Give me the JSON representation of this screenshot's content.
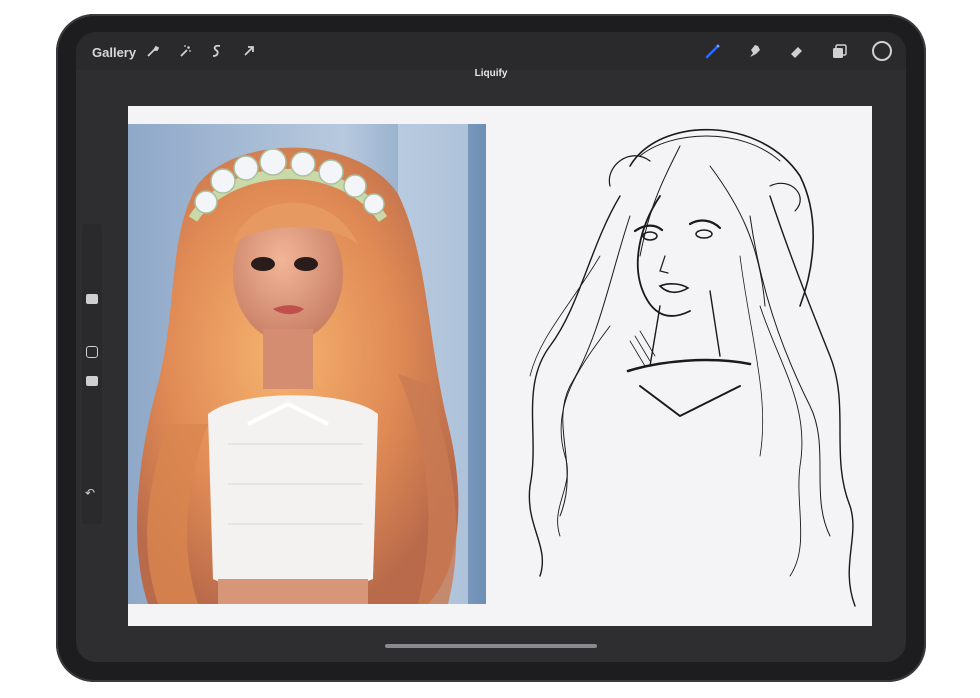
{
  "toolbar": {
    "gallery_label": "Gallery",
    "left_tools": [
      "wrench-icon",
      "magic-wand-icon",
      "selection-icon",
      "move-arrow-icon"
    ],
    "right_tools": [
      "brush-icon",
      "smudge-icon",
      "eraser-icon",
      "layers-icon",
      "color-picker"
    ],
    "active_tool_color": "#2b6bff"
  },
  "mode": {
    "title": "Liquify"
  },
  "sidebar": {
    "controls": [
      "brush-size-slider",
      "modify-button",
      "opacity-slider",
      "undo-button"
    ]
  },
  "canvas": {
    "background": "#f4f4f6",
    "reference_image": "doll-photo",
    "drawing": "girl-sketch"
  }
}
